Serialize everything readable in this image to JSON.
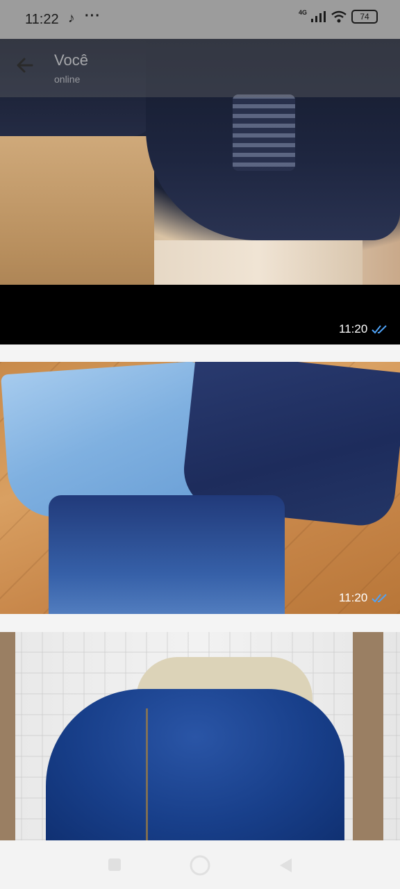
{
  "status_bar": {
    "time": "11:22",
    "tiktok_icon": "tiktok-icon",
    "more_dots": "···",
    "network": "4G",
    "battery": "74"
  },
  "header": {
    "contact_name": "Você",
    "contact_sub": "online"
  },
  "messages": [
    {
      "time": "11:20",
      "status": "read"
    },
    {
      "time": "11:20",
      "status": "read"
    }
  ],
  "colors": {
    "read_ticks": "#4fa3f7",
    "status_bar_bg": "#9c9c9c"
  },
  "nav": {
    "recents": "square-icon",
    "home": "circle-icon",
    "back": "triangle-back-icon"
  }
}
